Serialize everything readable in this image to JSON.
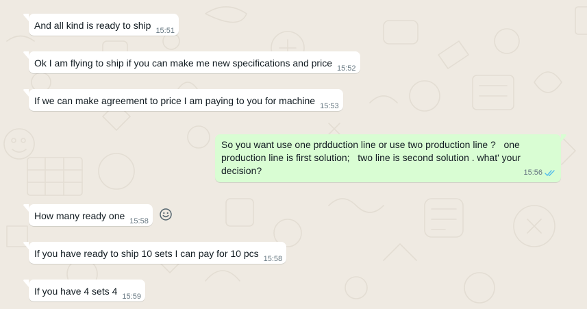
{
  "messages": [
    {
      "direction": "incoming",
      "text": "And all kind is ready to ship",
      "time": "15:51"
    },
    {
      "direction": "incoming",
      "text": "Ok I am flying to ship if you can make me new specifications and price",
      "time": "15:52"
    },
    {
      "direction": "incoming",
      "text": "If we can make agreement to price I am paying to you for machine",
      "time": "15:53"
    },
    {
      "direction": "outgoing",
      "text": "So you want use one prdduction line or use two production line ?   one production line is first solution;   two line is second solution . what' your decision?",
      "time": "15:56",
      "status": "read",
      "status_icon": "double-check-icon",
      "status_color": "#53bdeb"
    },
    {
      "direction": "incoming",
      "text": "How many ready one",
      "time": "15:58"
    },
    {
      "direction": "incoming",
      "text": "If you have ready to ship 10 sets I can pay for 10 pcs",
      "time": "15:58"
    },
    {
      "direction": "incoming",
      "text": "If you have 4 sets 4",
      "time": "15:59"
    }
  ],
  "reaction_button": {
    "icon": "smiley-icon"
  },
  "colors": {
    "background": "#efeae2",
    "incoming_bubble": "#ffffff",
    "outgoing_bubble": "#d9fdd3",
    "text": "#111b21",
    "timestamp": "#667781",
    "read_ticks": "#53bdeb"
  }
}
